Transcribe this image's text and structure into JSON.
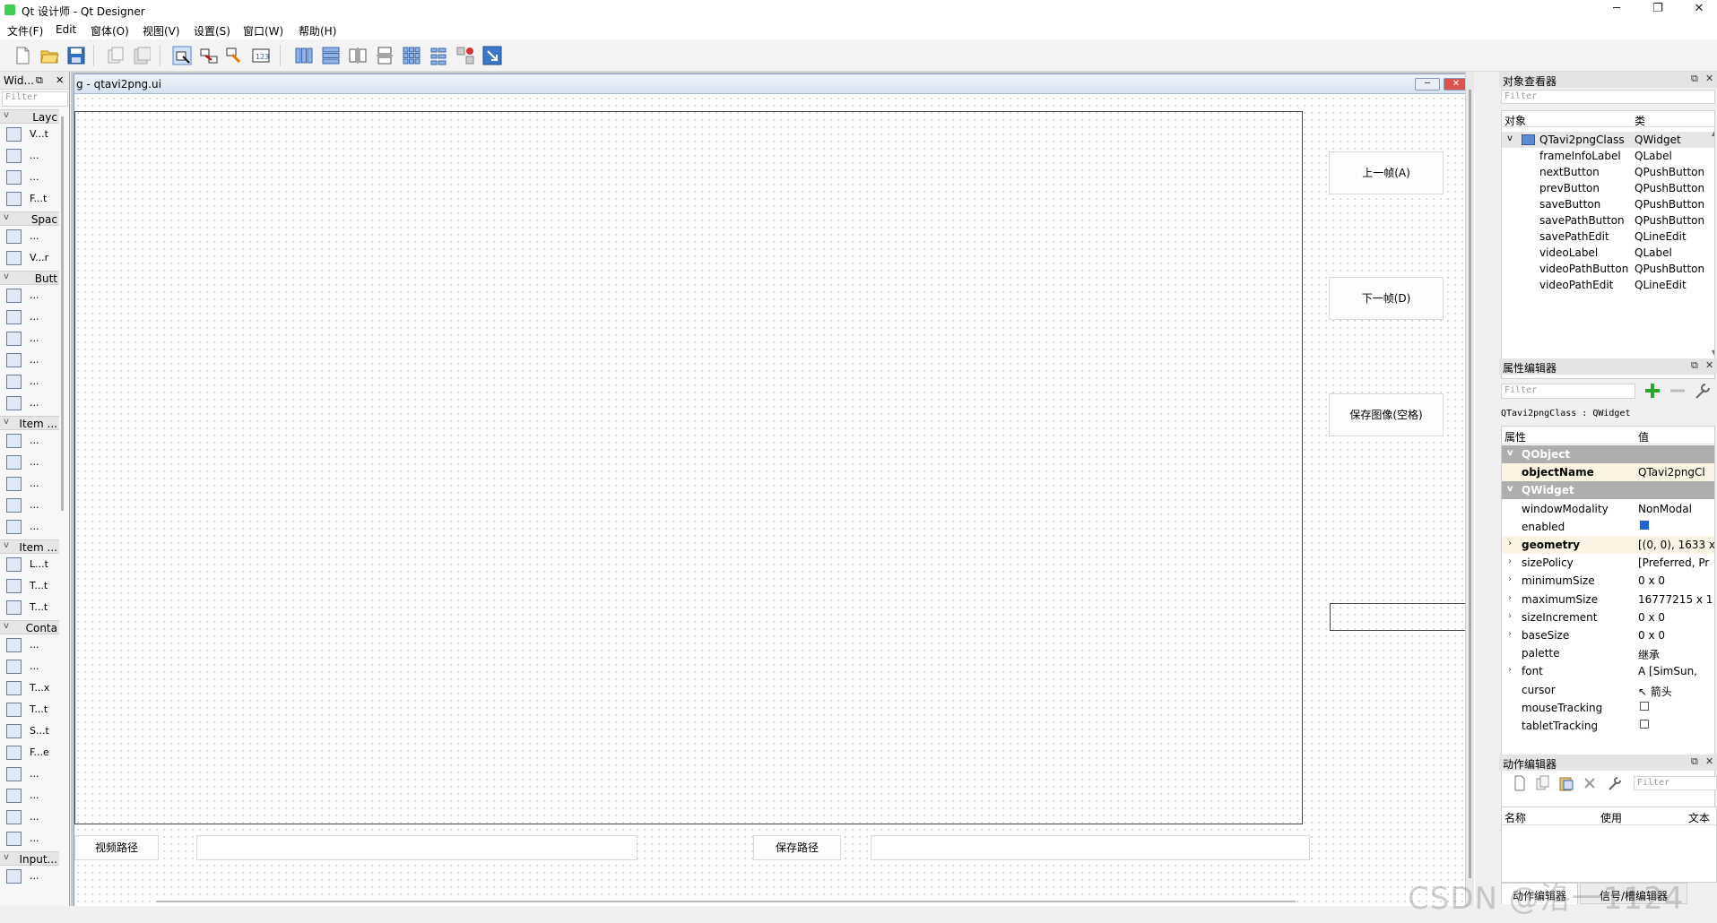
{
  "window": {
    "title": "Qt 设计师 - Qt Designer",
    "minimize": "─",
    "maximize": "❐",
    "close": "✕"
  },
  "menubar": [
    "文件(F)",
    "Edit",
    "窗体(O)",
    "视图(V)",
    "设置(S)",
    "窗口(W)",
    "帮助(H)"
  ],
  "widget_box": {
    "title": "Wid...",
    "float_glyph": "⧉",
    "close_glyph": "✕",
    "filter_placeholder": "Filter",
    "categories": [
      {
        "label": "Layc",
        "items": [
          "V...t",
          "...",
          "...",
          "F...t"
        ]
      },
      {
        "label": "Spac",
        "items": [
          "...",
          "V...r"
        ]
      },
      {
        "label": "Butt",
        "items": [
          "...",
          "...",
          "...",
          "...",
          "...",
          "..."
        ]
      },
      {
        "label": "Item ...",
        "items": [
          "...",
          "...",
          "...",
          "...",
          "..."
        ]
      },
      {
        "label": "Item ...",
        "items": [
          "L...t",
          "T...t",
          "T...t"
        ]
      },
      {
        "label": "Conta",
        "items": [
          "...",
          "...",
          "T...x",
          "T...t",
          "S...t",
          "F...e",
          "...",
          "...",
          "...",
          "..."
        ]
      },
      {
        "label": "Input...",
        "items": [
          "..."
        ]
      }
    ]
  },
  "form": {
    "title": "g - qtavi2png.ui",
    "min_glyph": "─",
    "close_glyph": "✕",
    "prev_button": "上一帧(A)",
    "next_button": "下一帧(D)",
    "save_button": "保存图像(空格)",
    "video_path_button": "视频路径",
    "save_path_button": "保存路径"
  },
  "object_inspector": {
    "title": "对象查看器",
    "filter_placeholder": "Filter",
    "col_object": "对象",
    "col_class": "类",
    "root": {
      "name": "QTavi2pngClass",
      "class": "QWidget"
    },
    "children": [
      {
        "name": "frameInfoLabel",
        "class": "QLabel"
      },
      {
        "name": "nextButton",
        "class": "QPushButton"
      },
      {
        "name": "prevButton",
        "class": "QPushButton"
      },
      {
        "name": "saveButton",
        "class": "QPushButton"
      },
      {
        "name": "savePathButton",
        "class": "QPushButton"
      },
      {
        "name": "savePathEdit",
        "class": "QLineEdit"
      },
      {
        "name": "videoLabel",
        "class": "QLabel"
      },
      {
        "name": "videoPathButton",
        "class": "QPushButton"
      },
      {
        "name": "videoPathEdit",
        "class": "QLineEdit"
      }
    ]
  },
  "property_editor": {
    "title": "属性编辑器",
    "filter_placeholder": "Filter",
    "context": "QTavi2pngClass : QWidget",
    "col_property": "属性",
    "col_value": "值",
    "rows": [
      {
        "name": "QObject",
        "value": "",
        "group": true
      },
      {
        "name": "objectName",
        "value": "QTavi2pngCl",
        "bold": true
      },
      {
        "name": "QWidget",
        "value": "",
        "group": true
      },
      {
        "name": "windowModality",
        "value": "NonModal"
      },
      {
        "name": "enabled",
        "value": "",
        "check": "on"
      },
      {
        "name": "geometry",
        "value": "[(0, 0), 1633 x",
        "bold": true,
        "expand": true
      },
      {
        "name": "sizePolicy",
        "value": "[Preferred, Pr",
        "expand": true
      },
      {
        "name": "minimumSize",
        "value": "0 x 0",
        "expand": true
      },
      {
        "name": "maximumSize",
        "value": "16777215 x 1",
        "expand": true
      },
      {
        "name": "sizeIncrement",
        "value": "0 x 0",
        "expand": true
      },
      {
        "name": "baseSize",
        "value": "0 x 0",
        "expand": true
      },
      {
        "name": "palette",
        "value": "继承"
      },
      {
        "name": "font",
        "value": "A  [SimSun,",
        "expand": true
      },
      {
        "name": "cursor",
        "value": "↖  箭头"
      },
      {
        "name": "mouseTracking",
        "value": "",
        "check": "off"
      },
      {
        "name": "tabletTracking",
        "value": "",
        "check": "off"
      }
    ]
  },
  "action_editor": {
    "title": "动作编辑器",
    "filter_placeholder": "Filter",
    "col_name": "名称",
    "col_used": "使用",
    "col_text": "文本",
    "tab_action": "动作编辑器",
    "tab_signal": "信号/槽编辑器"
  },
  "watermark": "CSDN @洛一1124",
  "colors": {
    "group_bg": "#aeaeae",
    "accent": "#1b63d6",
    "bold_row_bg": "#fdf3e3"
  }
}
